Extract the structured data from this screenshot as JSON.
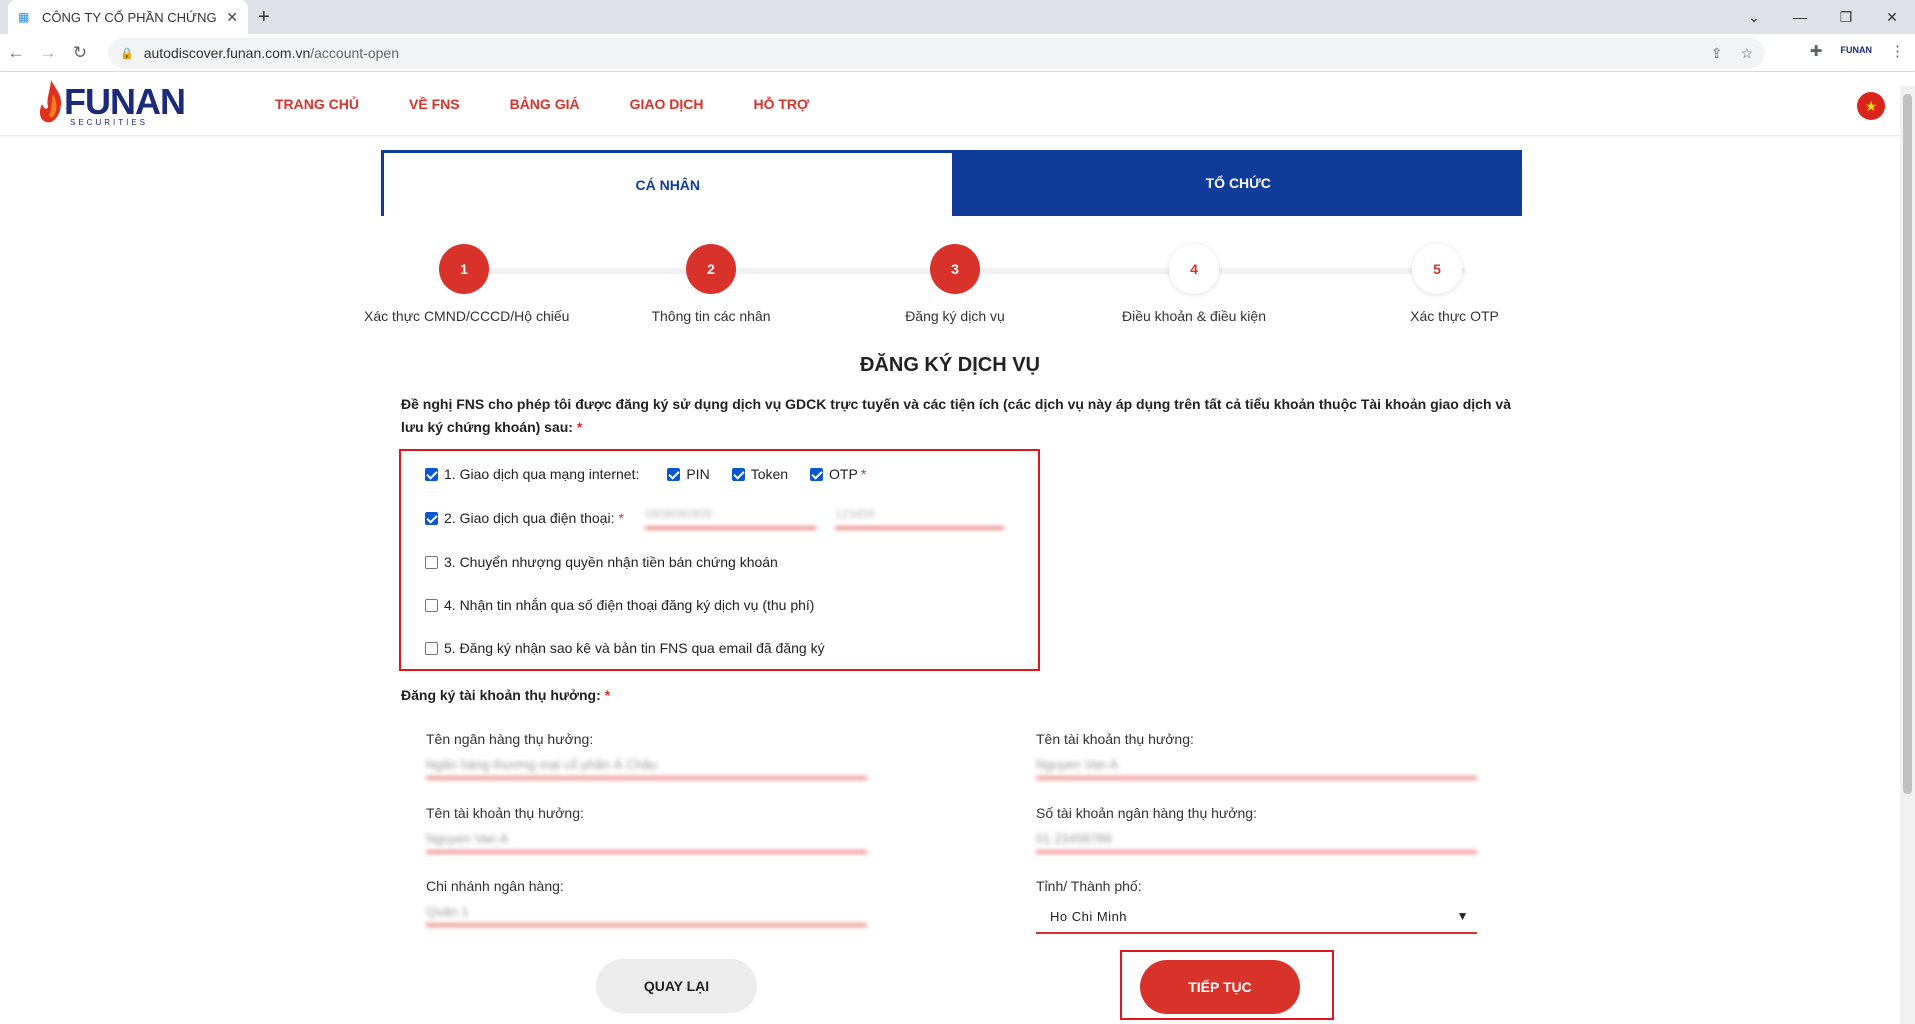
{
  "browser": {
    "tab_title": "CÔNG TY CỔ PHẦN CHỨNG KHO",
    "url_host": "autodiscover.funan.com.vn",
    "url_path": "/account-open"
  },
  "site": {
    "logo_text": "FUNAN",
    "logo_sub": "SECURITIES",
    "menu": [
      "TRANG CHỦ",
      "VỀ FNS",
      "BẢNG GIÁ",
      "GIAO DỊCH",
      "HỖ TRỢ"
    ],
    "flag": "★"
  },
  "account_types": {
    "individual": "CÁ NHÂN",
    "organization": "TỔ CHỨC"
  },
  "steps": [
    {
      "num": "1",
      "label": "Xác thực CMND/CCCD/Hộ chiếu"
    },
    {
      "num": "2",
      "label": "Thông tin các nhân"
    },
    {
      "num": "3",
      "label": "Đăng ký dịch vụ"
    },
    {
      "num": "4",
      "label": "Điều khoản & điều kiện"
    },
    {
      "num": "5",
      "label": "Xác thực OTP"
    }
  ],
  "form": {
    "title": "ĐĂNG KÝ DỊCH VỤ",
    "intro": "Đề nghị FNS cho phép tôi được đăng ký sử dụng dịch vụ GDCK trực tuyến và các tiện ích (các dịch vụ này áp dụng trên tất cả tiểu khoản thuộc Tài khoản giao dịch và lưu ký chứng khoán) sau:",
    "required_mark": "*",
    "services": {
      "s1": "1. Giao dịch qua mạng internet:",
      "pin": "PIN",
      "token": "Token",
      "otp": "OTP",
      "s2": "2. Giao dịch qua điện thoại:",
      "phone1": "0909090909",
      "phone2": "123456",
      "s3": "3. Chuyển nhượng quyền nhận tiền bán chứng khoán",
      "s4": "4. Nhận tin nhắn qua số điện thoại đăng ký dịch vụ (thu phí)",
      "s5": "5. Đăng ký nhận sao kê và bản tin FNS qua email đã đăng ký"
    },
    "beneficiary_title": "Đăng ký tài khoản thụ hưởng:",
    "fields": {
      "bank_name_label": "Tên ngân hàng thụ hưởng:",
      "bank_name_value": "Ngân hàng thương mại cổ phần Á Châu",
      "acc_name_right_label": "Tên tài khoản thụ hưởng:",
      "acc_name_right_value": "Nguyen Van A",
      "acc_name_label": "Tên tài khoản thụ hưởng:",
      "acc_name_value": "Nguyen Van A",
      "acc_number_label": "Số tài khoản ngân hàng thụ hưởng:",
      "acc_number_value": "01 23456789",
      "branch_label": "Chi nhánh ngân hàng:",
      "branch_value": "Quận 1",
      "city_label": "Tỉnh/ Thành phố:",
      "city_value": "Ho Chi Minh"
    },
    "back_button": "QUAY LẠI",
    "next_button": "TIẾP TỤC"
  }
}
